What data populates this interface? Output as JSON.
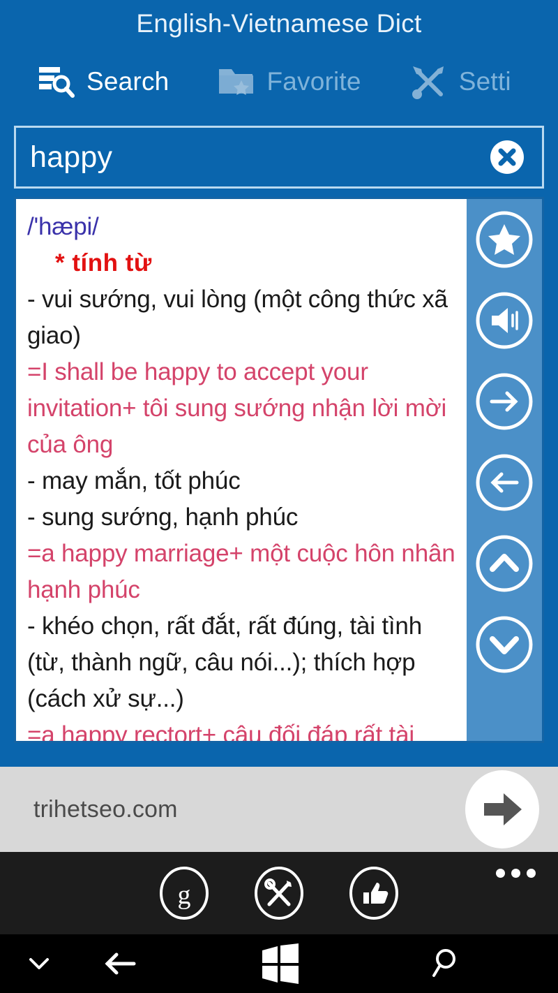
{
  "app": {
    "title": "English-Vietnamese Dict",
    "accent_color": "#0a65ad",
    "rail_color": "#4b90c8",
    "phonetic_color": "#3a32aa",
    "pos_color": "#e21111",
    "example_color": "#d4436a"
  },
  "pivot": {
    "items": [
      {
        "label": "Search",
        "icon": "search-list-icon",
        "active": true
      },
      {
        "label": "Favorite",
        "icon": "folder-star-icon",
        "active": false
      },
      {
        "label": "Setti",
        "icon": "tools-icon",
        "active": false
      }
    ]
  },
  "search": {
    "value": "happy",
    "placeholder": "",
    "clear_icon": "clear-circle-icon"
  },
  "definition": {
    "lines": [
      {
        "text": "/'hæpi/",
        "style": "phonetic"
      },
      {
        "text": "*  tính từ",
        "style": "pos"
      },
      {
        "text": "- vui sướng, vui lòng (một công thức xã giao)",
        "style": "plain"
      },
      {
        "text": "=I shall be happy to accept your invitation+ tôi sung sướng nhận lời mời của ông",
        "style": "example"
      },
      {
        "text": "- may mắn, tốt phúc",
        "style": "plain"
      },
      {
        "text": "- sung sướng, hạnh phúc",
        "style": "plain"
      },
      {
        "text": "=a happy marriage+ một cuộc hôn nhân hạnh phúc",
        "style": "example"
      },
      {
        "text": "- khéo chọn, rất đắt, rất đúng, tài tình (từ, thành ngữ, câu nói...); thích hợp (cách xử sự...)",
        "style": "plain"
      },
      {
        "text": "=a happy rectort+ câu đối đáp rất tài tình",
        "style": "example"
      }
    ]
  },
  "rail": {
    "buttons": [
      {
        "name": "favorite-star-button",
        "icon": "star-icon"
      },
      {
        "name": "speak-button",
        "icon": "speaker-icon"
      },
      {
        "name": "forward-button",
        "icon": "arrow-right-icon"
      },
      {
        "name": "backward-button",
        "icon": "arrow-left-icon"
      },
      {
        "name": "scroll-up-button",
        "icon": "chevron-up-icon"
      },
      {
        "name": "scroll-down-button",
        "icon": "chevron-down-icon"
      }
    ]
  },
  "ad": {
    "text": "trihetseo.com",
    "cta_icon": "arrow-right-solid-icon",
    "background": "#d8d8d8"
  },
  "appbar": {
    "buttons": [
      {
        "name": "google-button",
        "icon": "google-g-icon"
      },
      {
        "name": "tools-button",
        "icon": "tools-icon"
      },
      {
        "name": "thumbs-up-button",
        "icon": "thumbs-up-icon"
      }
    ],
    "more_label": "..."
  },
  "navbar": {
    "buttons": [
      {
        "name": "nav-collapse-button",
        "icon": "chevron-down-icon"
      },
      {
        "name": "nav-back-button",
        "icon": "arrow-left-icon"
      },
      {
        "name": "nav-start-button",
        "icon": "windows-logo-icon"
      },
      {
        "name": "nav-search-button",
        "icon": "search-icon"
      }
    ]
  }
}
